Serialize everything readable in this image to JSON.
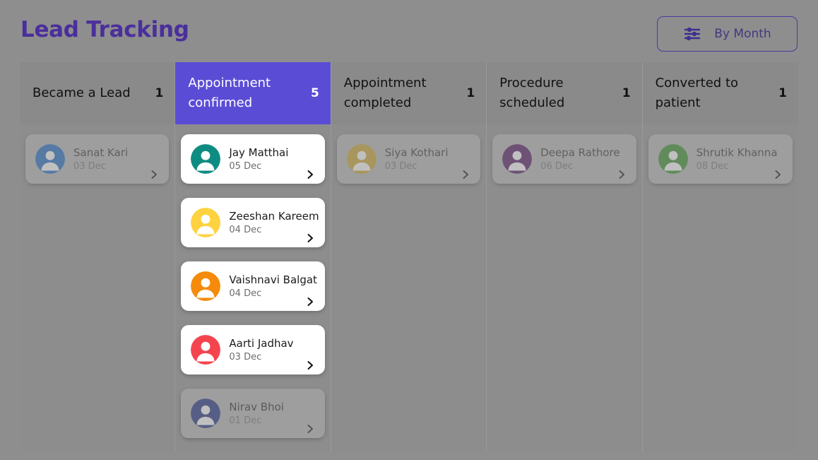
{
  "header": {
    "title": "Lead Tracking",
    "filter_button": {
      "label": "By Month",
      "icon": "sliders-icon"
    },
    "accent_color": "#5b4cd6",
    "title_color": "#4a2f9c"
  },
  "board": {
    "columns": [
      {
        "id": "became-a-lead",
        "title": "Became a Lead",
        "count": "1",
        "active": false,
        "cards": [
          {
            "name": "Sanat Kari",
            "date": "03 Dec",
            "avatar_color": "#1565c0",
            "avatar_icon": "person-icon",
            "chevron": "chevron-right-icon"
          }
        ]
      },
      {
        "id": "appointment-confirmed",
        "title": "Appointment confirmed",
        "count": "5",
        "active": true,
        "cards": [
          {
            "name": "Jay Matthai",
            "date": "05 Dec",
            "avatar_color": "#0f8c82",
            "avatar_icon": "person-icon",
            "chevron": "chevron-right-icon"
          },
          {
            "name": "Zeeshan Kareem",
            "date": "04 Dec",
            "avatar_color": "#ffd23f",
            "avatar_icon": "person-icon",
            "chevron": "chevron-right-icon"
          },
          {
            "name": "Vaishnavi Balgat",
            "date": "04 Dec",
            "avatar_color": "#f58a0b",
            "avatar_icon": "person-icon",
            "chevron": "chevron-right-icon"
          },
          {
            "name": "Aarti Jadhav",
            "date": "03 Dec",
            "avatar_color": "#f4454f",
            "avatar_icon": "person-icon",
            "chevron": "chevron-right-icon"
          },
          {
            "name": "Nirav Bhoi",
            "date": "01 Dec",
            "avatar_color": "#17267e",
            "avatar_icon": "person-icon",
            "chevron": "chevron-right-icon"
          }
        ]
      },
      {
        "id": "appointment-completed",
        "title": "Appointment completed",
        "count": "1",
        "active": false,
        "cards": [
          {
            "name": "Siya Kothari",
            "date": "03 Dec",
            "avatar_color": "#c9a227",
            "avatar_icon": "person-icon",
            "chevron": "chevron-right-icon"
          }
        ]
      },
      {
        "id": "procedure-scheduled",
        "title": "Procedure scheduled",
        "count": "1",
        "active": false,
        "cards": [
          {
            "name": "Deepa Rathore",
            "date": "06 Dec",
            "avatar_color": "#4a0d5c",
            "avatar_icon": "person-icon",
            "chevron": "chevron-right-icon"
          }
        ]
      },
      {
        "id": "converted-to-patient",
        "title": "Converted to patient",
        "count": "1",
        "active": false,
        "cards": [
          {
            "name": "Shrutik Khanna",
            "date": "08 Dec",
            "avatar_color": "#2e8b1f",
            "avatar_icon": "person-icon",
            "chevron": "chevron-right-icon"
          }
        ]
      }
    ]
  }
}
